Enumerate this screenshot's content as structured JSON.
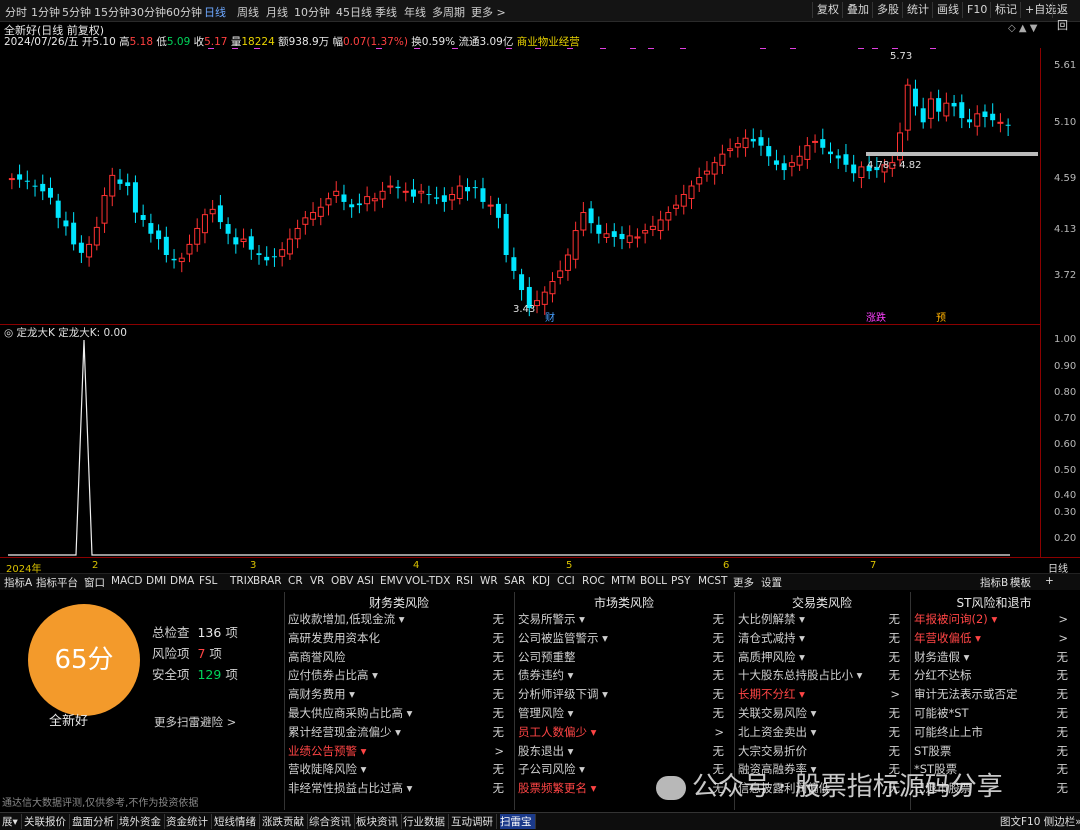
{
  "topbar": {
    "periods": [
      "分时",
      "1分钟",
      "5分钟",
      "15分钟",
      "30分钟",
      "60分钟",
      "日线",
      "周线",
      "月线",
      "10分钟",
      "45日线",
      "季线",
      "年线",
      "多周期",
      "更多 >"
    ],
    "active_index": 6,
    "right_buttons": [
      "复权",
      "叠加",
      "多股",
      "统计",
      "画线",
      "F10",
      "标记",
      "+自选",
      "返回"
    ]
  },
  "info": {
    "title": "全新好(日线 前复权)",
    "date": "2024/07/26/五",
    "open_label": "开",
    "open": "5.10",
    "high_label": "高",
    "high": "5.18",
    "low_label": "低",
    "low": "5.09",
    "close_label": "收",
    "close": "5.17",
    "vol_label": "量",
    "vol": "18224",
    "amt_label": "额",
    "amt": "938.9万",
    "chg_label": "幅",
    "chg": "0.07(1.37%)",
    "turn_label": "换",
    "turn": "0.59%",
    "float_label": "流通",
    "float": "3.09亿",
    "industry": "商业物业经营"
  },
  "chart_data": {
    "type": "candlestick",
    "yaxis_ticks": [
      "5.61",
      "5.10",
      "4.59",
      "4.13",
      "3.72"
    ],
    "annotations": {
      "high": "5.73",
      "low": "3.43",
      "range": "4.78 - 4.82"
    },
    "markers": [
      "财",
      "涨跌",
      "预"
    ],
    "sub_indicator": {
      "name": "定龙大K",
      "label": "定龙大K: 0.00",
      "yticks": [
        "1.00",
        "0.90",
        "0.80",
        "0.70",
        "0.60",
        "0.50",
        "0.40",
        "0.30",
        "0.20"
      ]
    },
    "x_labels": [
      "2024年",
      "2",
      "3",
      "4",
      "5",
      "6",
      "7"
    ],
    "axis_label": "日线"
  },
  "tabs": [
    "指标A",
    "指标平台",
    "窗口",
    "MACD",
    "DMI",
    "DMA",
    "FSL",
    "TRIX",
    "BRAR",
    "CR",
    "VR",
    "OBV",
    "ASI",
    "EMV",
    "VOL-TDX",
    "RSI",
    "WR",
    "SAR",
    "KDJ",
    "CCI",
    "ROC",
    "MTM",
    "BOLL",
    "PSY",
    "MCST",
    "更多",
    "设置"
  ],
  "tabs_right": [
    "指标B",
    "模板",
    "+"
  ],
  "panel": {
    "score": "65分",
    "stock_name": "全新好",
    "total_label": "总检查",
    "total": "136",
    "unit": "项",
    "risk_label": "风险项",
    "risk": "7",
    "safe_label": "安全项",
    "safe": "129",
    "more_link": "更多扫雷避险 >",
    "disclaimer": "通达信大数据评测,仅供参考,不作为投资依据",
    "columns": [
      {
        "title": "财务类风险",
        "rows": [
          {
            "name": "应收款增加,低现金流 ▾",
            "val": "无",
            "risk": false
          },
          {
            "name": "高研发费用资本化",
            "val": "无",
            "risk": false
          },
          {
            "name": "高商誉风险",
            "val": "无",
            "risk": false
          },
          {
            "name": "应付债券占比高 ▾",
            "val": "无",
            "risk": false
          },
          {
            "name": "高财务费用 ▾",
            "val": "无",
            "risk": false
          },
          {
            "name": "最大供应商采购占比高 ▾",
            "val": "无",
            "risk": false
          },
          {
            "name": "累计经营现金流偏少 ▾",
            "val": "无",
            "risk": false
          },
          {
            "name": "业绩公告预警 ▾",
            "val": ">",
            "risk": true
          },
          {
            "name": "营收陡降风险 ▾",
            "val": "无",
            "risk": false
          },
          {
            "name": "非经常性损益占比过高 ▾",
            "val": "无",
            "risk": false
          }
        ]
      },
      {
        "title": "市场类风险",
        "rows": [
          {
            "name": "交易所警示 ▾",
            "val": "无",
            "risk": false
          },
          {
            "name": "公司被监管警示 ▾",
            "val": "无",
            "risk": false
          },
          {
            "name": "公司预重整",
            "val": "无",
            "risk": false
          },
          {
            "name": "债券违约 ▾",
            "val": "无",
            "risk": false
          },
          {
            "name": "分析师评级下调 ▾",
            "val": "无",
            "risk": false
          },
          {
            "name": "管理风险 ▾",
            "val": "无",
            "risk": false
          },
          {
            "name": "员工人数偏少 ▾",
            "val": ">",
            "risk": true
          },
          {
            "name": "股东退出 ▾",
            "val": "无",
            "risk": false
          },
          {
            "name": "子公司风险 ▾",
            "val": "无",
            "risk": false
          },
          {
            "name": "股票频繁更名 ▾",
            "val": "无",
            "risk": true
          }
        ]
      },
      {
        "title": "交易类风险",
        "rows": [
          {
            "name": "大比例解禁 ▾",
            "val": "无",
            "risk": false
          },
          {
            "name": "清仓式减持 ▾",
            "val": "无",
            "risk": false
          },
          {
            "name": "高质押风险 ▾",
            "val": "无",
            "risk": false
          },
          {
            "name": "十大股东总持股占比小 ▾",
            "val": "无",
            "risk": false
          },
          {
            "name": "长期不分红 ▾",
            "val": ">",
            "risk": true
          },
          {
            "name": "关联交易风险 ▾",
            "val": "无",
            "risk": false
          },
          {
            "name": "北上资金卖出 ▾",
            "val": "无",
            "risk": false
          },
          {
            "name": "大宗交易折价",
            "val": "无",
            "risk": false
          },
          {
            "name": "融资高融券率 ▾",
            "val": "无",
            "risk": false
          },
          {
            "name": "信息披露利润偏低",
            "val": "无",
            "risk": false
          }
        ]
      },
      {
        "title": "ST风险和退市",
        "rows": [
          {
            "name": "年报被问询(2) ▾",
            "val": ">",
            "risk": true
          },
          {
            "name": "年营收偏低 ▾",
            "val": ">",
            "risk": true
          },
          {
            "name": "财务造假 ▾",
            "val": "无",
            "risk": false
          },
          {
            "name": "分红不达标",
            "val": "无",
            "risk": false
          },
          {
            "name": "审计无法表示或否定",
            "val": "无",
            "risk": false
          },
          {
            "name": "可能被*ST",
            "val": "无",
            "risk": false
          },
          {
            "name": "可能终止上市",
            "val": "无",
            "risk": false
          },
          {
            "name": "ST股票",
            "val": "无",
            "risk": false
          },
          {
            "name": "*ST股票",
            "val": "无",
            "risk": false
          },
          {
            "name": "已退市股票",
            "val": "无",
            "risk": false
          }
        ]
      }
    ]
  },
  "watermark": "公众号 · 股票指标源码分享",
  "bottombar": [
    "展▾",
    "关联报价",
    "盘面分析",
    "境外资金",
    "资金统计",
    "短线情绪",
    "涨跌贡献",
    "综合资讯",
    "板块资讯",
    "行业数据",
    "互动调研",
    "扫雷宝"
  ],
  "bottombar_selected": 11,
  "bottombar_right": "图文F10 侧边栏»",
  "colors": {
    "up": "#ff3232",
    "down": "#00e6ff",
    "accent": "#f39a2b",
    "risk_text": "#ff4545"
  }
}
